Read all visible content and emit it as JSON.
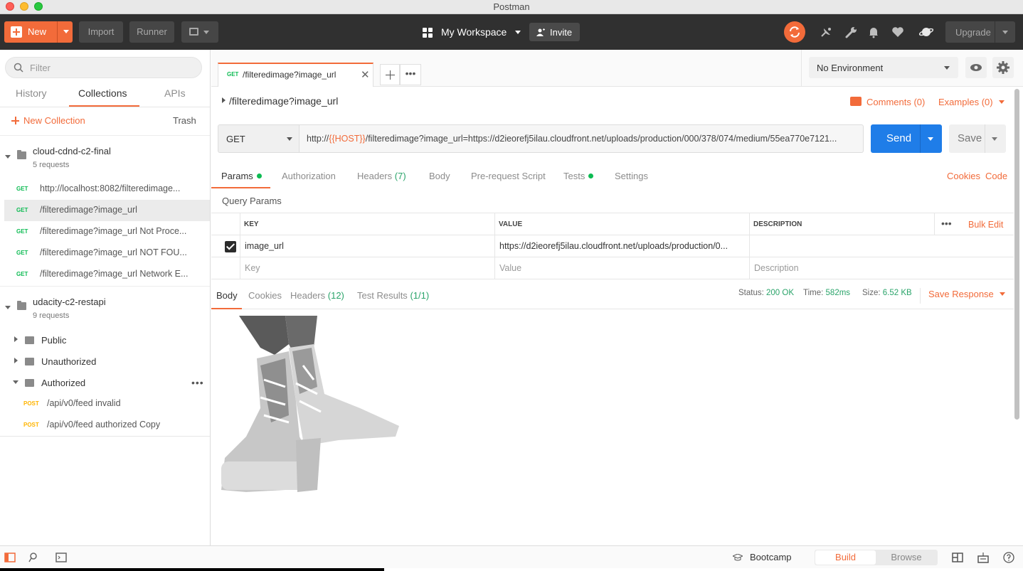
{
  "window": {
    "title": "Postman"
  },
  "toolbar": {
    "new_label": "New",
    "import_label": "Import",
    "runner_label": "Runner",
    "workspace_label": "My Workspace",
    "invite_label": "Invite",
    "upgrade_label": "Upgrade"
  },
  "sidebar": {
    "filter_placeholder": "Filter",
    "tabs": [
      "History",
      "Collections",
      "APIs"
    ],
    "active_tab": "Collections",
    "new_collection_label": "New Collection",
    "trash_label": "Trash",
    "collections": [
      {
        "name": "cloud-cdnd-c2-final",
        "count": "5 requests",
        "requests": [
          {
            "method": "GET",
            "name": "http://localhost:8082/filteredimage..."
          },
          {
            "method": "GET",
            "name": "/filteredimage?image_url"
          },
          {
            "method": "GET",
            "name": "/filteredimage?image_url Not Proce..."
          },
          {
            "method": "GET",
            "name": "/filteredimage?image_url NOT FOU..."
          },
          {
            "method": "GET",
            "name": "/filteredimage?image_url Network E..."
          }
        ]
      },
      {
        "name": "udacity-c2-restapi",
        "count": "9 requests",
        "folders": [
          "Public",
          "Unauthorized",
          "Authorized"
        ],
        "requests": [
          {
            "method": "POST",
            "name": "/api/v0/feed invalid"
          },
          {
            "method": "POST",
            "name": "/api/v0/feed authorized Copy"
          }
        ]
      }
    ]
  },
  "tab": {
    "method": "GET",
    "name": "/filteredimage?image_url"
  },
  "environment": {
    "selected": "No Environment"
  },
  "request": {
    "title": "/filteredimage?image_url",
    "comments_label": "Comments (0)",
    "examples_label": "Examples (0)",
    "method": "GET",
    "url_prefix": "http://",
    "url_var": "{{HOST}}",
    "url_rest": "/filteredimage?image_url=https://d2ieorefj5ilau.cloudfront.net/uploads/production/000/378/074/medium/55ea770e7121...",
    "send_label": "Send",
    "save_label": "Save",
    "tabs": {
      "params": "Params",
      "authorization": "Authorization",
      "headers": "Headers",
      "headers_count": "(7)",
      "body": "Body",
      "prerequest": "Pre-request Script",
      "tests": "Tests",
      "settings": "Settings",
      "cookies": "Cookies",
      "code": "Code"
    },
    "query_params_label": "Query Params",
    "table": {
      "headers": [
        "KEY",
        "VALUE",
        "DESCRIPTION"
      ],
      "bulk_edit": "Bulk Edit",
      "rows": [
        {
          "key": "image_url",
          "value": "https://d2ieorefj5ilau.cloudfront.net/uploads/production/0...",
          "checked": true
        }
      ],
      "placeholders": {
        "key": "Key",
        "value": "Value",
        "description": "Description"
      }
    }
  },
  "response": {
    "tabs": {
      "body": "Body",
      "cookies": "Cookies",
      "headers": "Headers",
      "headers_count": "(12)",
      "tests": "Test Results",
      "tests_count": "(1/1)"
    },
    "status_label": "Status:",
    "status": "200 OK",
    "time_label": "Time:",
    "time": "582ms",
    "size_label": "Size:",
    "size": "6.52 KB",
    "save_label": "Save Response"
  },
  "statusbar": {
    "bootcamp_label": "Bootcamp",
    "build_label": "Build",
    "browse_label": "Browse"
  },
  "colors": {
    "accent": "#f26b3a",
    "send": "#1f7de8",
    "get": "#0cbb52",
    "post": "#ffb400"
  }
}
